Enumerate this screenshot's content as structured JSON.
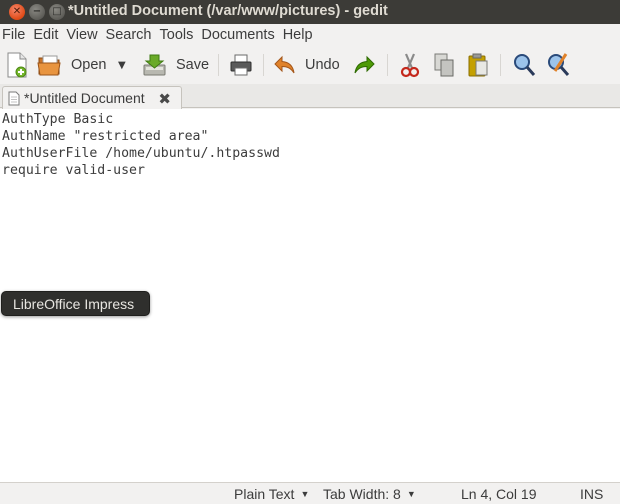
{
  "window": {
    "title": "*Untitled Document (/var/www/pictures) - gedit"
  },
  "menu": [
    "File",
    "Edit",
    "View",
    "Search",
    "Tools",
    "Documents",
    "Help"
  ],
  "toolbar": {
    "open_label": "Open",
    "save_label": "Save",
    "undo_label": "Undo"
  },
  "tab": {
    "label": "*Untitled Document"
  },
  "editor": {
    "lines": [
      "AuthType Basic",
      "AuthName \"restricted area\"",
      "AuthUserFile /home/ubuntu/.htpasswd",
      "require valid-user"
    ]
  },
  "tooltip": {
    "text": "LibreOffice Impress"
  },
  "statusbar": {
    "language": "Plain Text",
    "tab_width_label": "Tab Width:",
    "tab_width_value": "8",
    "position": "Ln 4, Col 19",
    "mode": "INS"
  },
  "colors": {
    "titlebar": "#3c3b37",
    "close_button": "#df4a16",
    "undo_arrow": "#e0822a",
    "redo_arrow": "#4e9a06",
    "paste_icon": "#c4a000"
  }
}
